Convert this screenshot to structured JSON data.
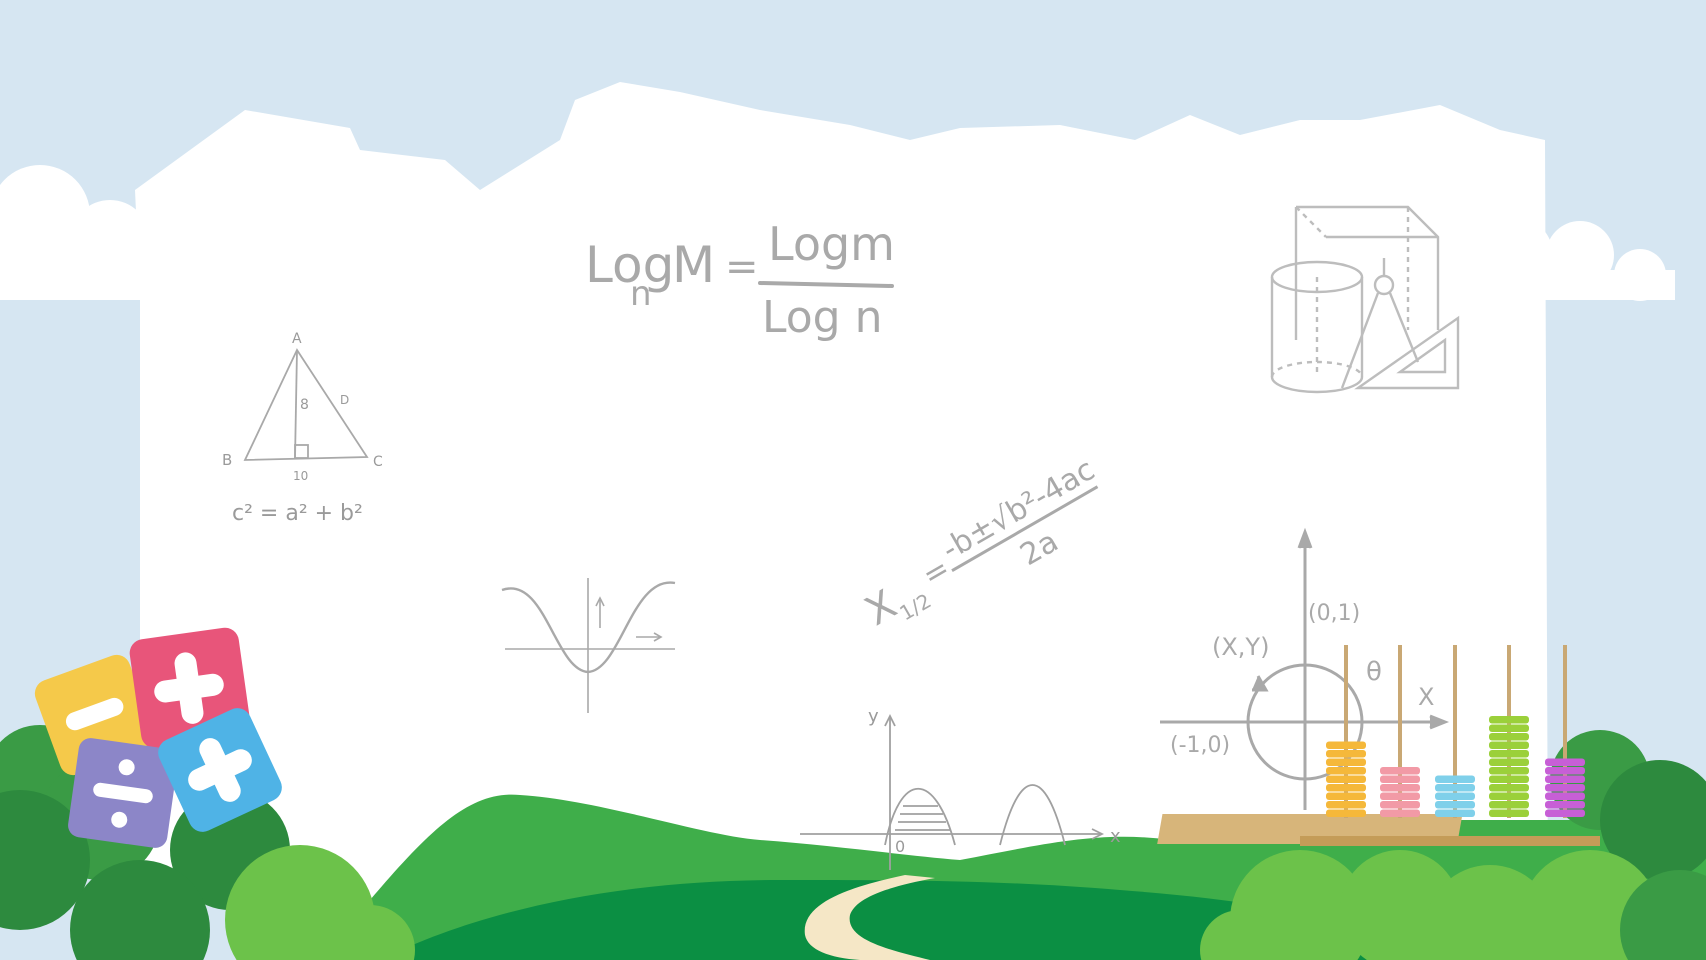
{
  "colors": {
    "sky": "#d6e6f2",
    "paper": "#ffffff",
    "sketch": "#a9a9a9",
    "hill_light": "#3fae4a",
    "hill_dark": "#0b8f43",
    "bush": "#6cc24a",
    "path": "#f5e7c6"
  },
  "math": {
    "log_formula": {
      "lhs_log": "Log",
      "lhs_base": "n",
      "lhs_arg": "M",
      "equals": "=",
      "numerator": "Logm",
      "denominator": "Log n"
    },
    "triangle": {
      "vertex_a": "A",
      "vertex_b": "B",
      "vertex_c": "C",
      "point_d": "D",
      "height": "8",
      "base": "10",
      "pythagoras": "c² = a² + b²"
    },
    "quadratic": {
      "lhs": "X",
      "lhs_sub": "1/2",
      "numerator": "-b±√b²-4ac",
      "denominator": "2a"
    },
    "unit_circle": {
      "point_xy": "(X,Y)",
      "point_01": "(0,1)",
      "point_m10": "(-1,0)",
      "theta": "θ",
      "axis_x": "X"
    },
    "wave_graph": {
      "axis_y": "y",
      "axis_x": "x",
      "origin": "0"
    }
  },
  "decor": {
    "tiles": [
      {
        "symbol": "−",
        "color": "#f5c94a",
        "icon": "minus-icon"
      },
      {
        "symbol": "+",
        "color": "#e8557a",
        "icon": "plus-icon"
      },
      {
        "symbol": "÷",
        "color": "#8c86c8",
        "icon": "divide-icon"
      },
      {
        "symbol": "+",
        "color": "#4fb3e6",
        "icon": "plus-icon"
      }
    ],
    "abacus_rods": [
      {
        "color": "#f5b83a",
        "beads": 9
      },
      {
        "color": "#f29aa6",
        "beads": 6
      },
      {
        "color": "#7fd0ea",
        "beads": 5
      },
      {
        "color": "#9bd03a",
        "beads": 12
      },
      {
        "color": "#c75fd6",
        "beads": 7
      }
    ]
  }
}
